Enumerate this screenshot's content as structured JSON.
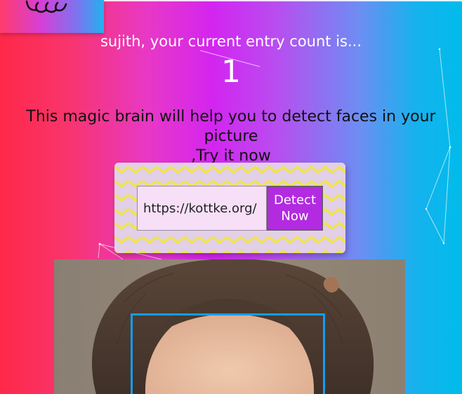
{
  "header": {
    "logo_icon": "brain-icon"
  },
  "greeting": {
    "user_name": "sujith",
    "text": "sujith, your current entry count is..."
  },
  "entry_count": "1",
  "tagline": {
    "line1": "This magic brain will help you to detect faces in your picture",
    "line2": ",Try it now"
  },
  "form": {
    "url_value": "https://kottke.org/",
    "button_line1": "Detect",
    "button_line2": "Now"
  },
  "result": {
    "face_detected": true,
    "box_color": "#149df2"
  },
  "colors": {
    "gradient_start": "#ff2848",
    "gradient_mid": "#d325f0",
    "gradient_end": "#00bcea",
    "button": "#b22be0",
    "pattern_zigzag": "#f0e44a",
    "pattern_base": "#e2cfe8"
  }
}
